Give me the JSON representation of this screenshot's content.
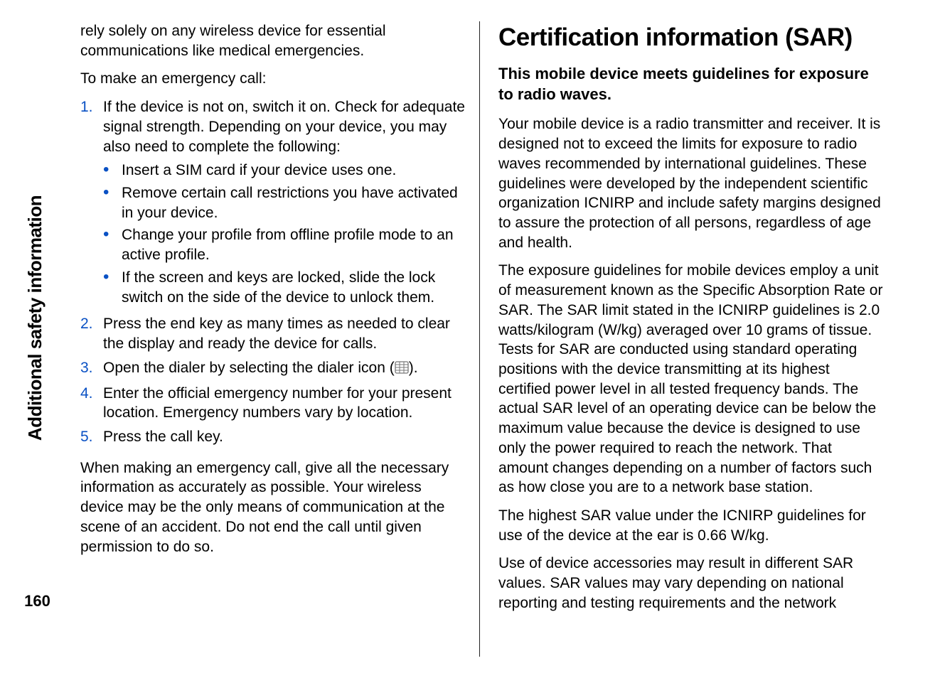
{
  "side_tab": "Additional safety information",
  "page_number": "160",
  "left": {
    "intro1": "rely solely on any wireless device for essential communications like medical emergencies.",
    "intro2": "To make an emergency call:",
    "ol": {
      "i1": {
        "num": "1.",
        "text": "If the device is not on, switch it on. Check for adequate signal strength. Depending on your device, you may also need to complete the following:",
        "bullets": {
          "b1": "Insert a SIM card if your device uses one.",
          "b2": "Remove certain call restrictions you have activated in your device.",
          "b3": "Change your profile from offline profile mode to an active profile.",
          "b4": "If the screen and keys are locked, slide the lock switch on the side of the device to unlock them."
        }
      },
      "i2": {
        "num": "2.",
        "text": "Press the end key as many times as needed to clear the display and ready the device for calls."
      },
      "i3": {
        "num": "3.",
        "text_a": "Open the dialer by selecting the dialer icon (",
        "text_b": ")."
      },
      "i4": {
        "num": "4.",
        "text": "Enter the official emergency number for your present location. Emergency numbers vary by location."
      },
      "i5": {
        "num": "5.",
        "text": "Press the call key."
      }
    },
    "outro": "When making an emergency call, give all the necessary information as accurately as possible. Your wireless device may be the only means of communication at the scene of an accident. Do not end the call until given permission to do so."
  },
  "right": {
    "h1": "Certification information (SAR)",
    "sub": "This mobile device meets guidelines for exposure to radio waves.",
    "p1": "Your mobile device is a radio transmitter and receiver. It is designed not to exceed the limits for exposure to radio waves recommended by international guidelines. These guidelines were developed by the independent scientific organization ICNIRP and include safety margins designed to assure the protection of all persons, regardless of age and health.",
    "p2": "The exposure guidelines for mobile devices employ a unit of measurement known as the Specific Absorption Rate or SAR. The SAR limit stated in the ICNIRP guidelines is 2.0 watts/kilogram (W/kg) averaged over 10 grams of tissue. Tests for SAR are conducted using standard operating positions with the device transmitting at its highest certified power level in all tested frequency bands. The actual SAR level of an operating device can be below the maximum value because the device is designed to use only the power required to reach the network. That amount changes depending on a number of factors such as how close you are to a network base station.",
    "p3": "The highest SAR value under the ICNIRP guidelines for use of the device at the ear is 0.66 W/kg.",
    "p4": "Use of device accessories may result in different SAR values. SAR values may vary depending on national reporting and testing requirements and the network"
  }
}
